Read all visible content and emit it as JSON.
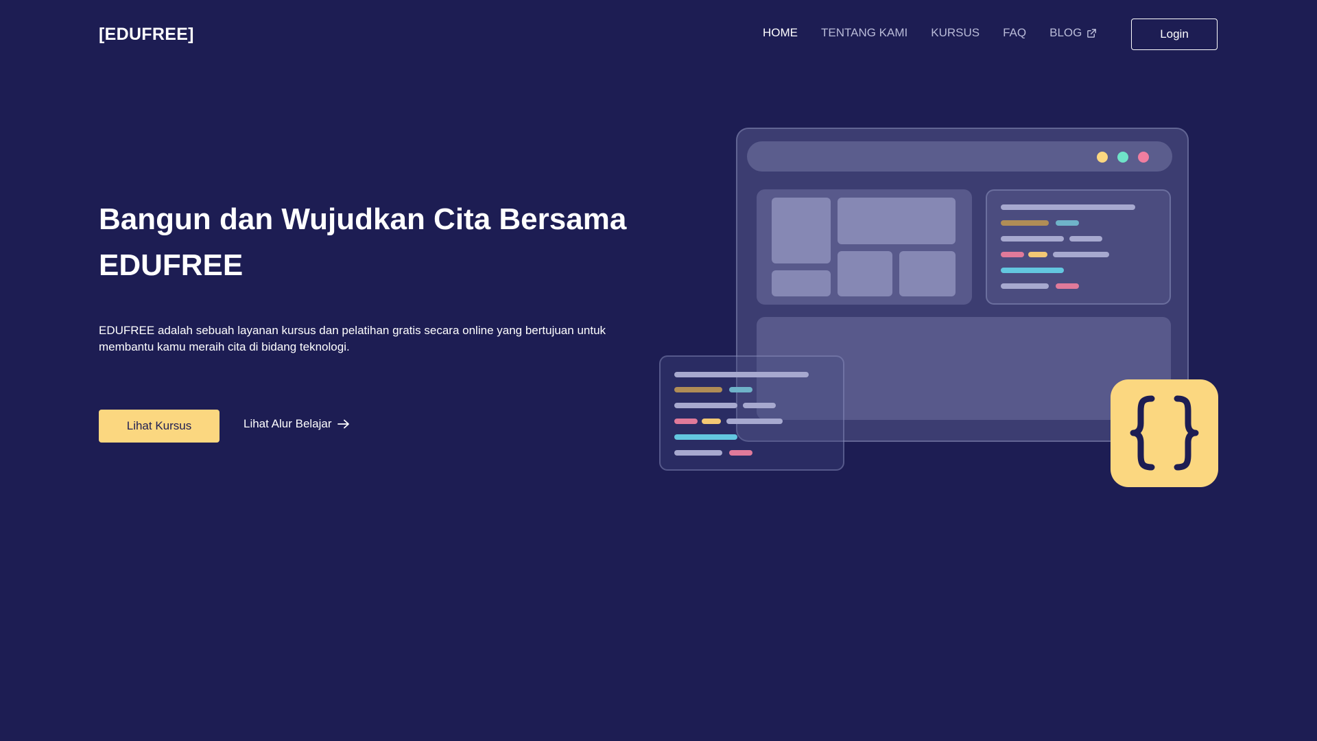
{
  "brand": {
    "logo_text": "[EDUFREE]"
  },
  "nav": {
    "items": [
      {
        "label": "HOME",
        "active": true
      },
      {
        "label": "TENTANG KAMI",
        "active": false
      },
      {
        "label": "KURSUS",
        "active": false
      },
      {
        "label": "FAQ",
        "active": false
      },
      {
        "label": "BLOG",
        "active": false,
        "icon": "external-link-icon"
      }
    ],
    "login_label": "Login"
  },
  "hero": {
    "title": "Bangun dan Wujudkan Cita Bersama EDUFREE",
    "description": "EDUFREE adalah sebuah layanan kursus dan pelatihan gratis secara online yang bertujuan untuk membantu kamu meraih cita di bidang teknologi.",
    "primary_button": "Lihat Kursus",
    "secondary_link": "Lihat Alur Belajar",
    "secondary_icon": "arrow-right-icon"
  },
  "illustration": {
    "icon": "curly-braces-icon",
    "window_dots": [
      "#fbd780",
      "#6fe3c8",
      "#f07ea0"
    ]
  },
  "colors": {
    "background": "#1d1d53",
    "accent": "#fbd780",
    "nav_inactive": "#b9bbd8",
    "text": "#ffffff"
  }
}
